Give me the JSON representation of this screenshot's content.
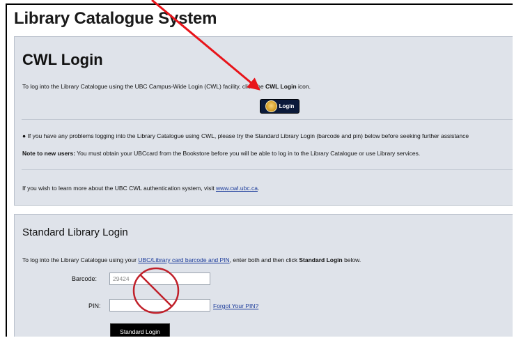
{
  "page": {
    "title": "Library Catalogue System"
  },
  "cwl": {
    "title": "CWL Login",
    "intro_prefix": "To log into the Library Catalogue using the UBC Campus-Wide Login (CWL) facility, click the ",
    "intro_bold": "CWL Login",
    "intro_suffix": " icon.",
    "login_button_label": "Login",
    "problems_text": "If you have any problems logging into the Library Catalogue using CWL, please try the Standard Library Login (barcode and pin) below before seeking further assistance",
    "new_users_label": "Note to new users:",
    "new_users_text": " You must obtain your UBCcard from the Bookstore before you will be able to log in to the Library Catalogue or use Library services.",
    "learn_more_prefix": "If you wish to learn more about the UBC CWL authentication system, visit ",
    "learn_more_link": "www.cwl.ubc.ca",
    "learn_more_suffix": "."
  },
  "standard": {
    "title": "Standard Library Login",
    "intro_prefix": "To log into the Library Catalogue using your ",
    "intro_link": "UBC/Library card barcode and PIN",
    "intro_middle": ", enter both and then click ",
    "intro_bold": "Standard Login",
    "intro_suffix": " below.",
    "barcode_label": "Barcode:",
    "barcode_value": "29424",
    "pin_label": "PIN:",
    "pin_value": "",
    "forgot_pin_link": "Forgot Your PIN?",
    "submit_label": "Standard Login"
  },
  "annotations": {
    "arrow_color": "#e8141a",
    "prohibition_color": "#c0202a"
  }
}
